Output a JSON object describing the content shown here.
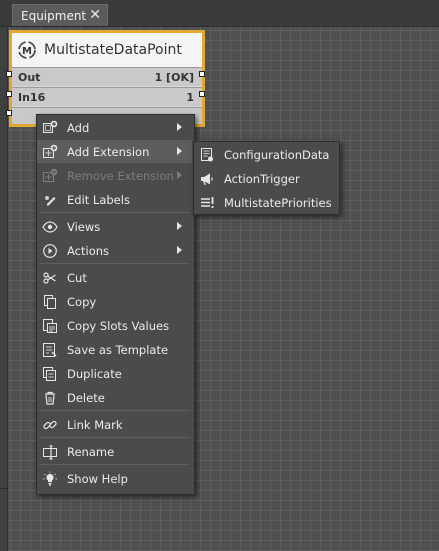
{
  "tab": {
    "label": "Equipment",
    "close": "✕"
  },
  "node": {
    "title": "MultistateDataPoint",
    "slots": [
      {
        "name": "Out",
        "value": "1 [OK]"
      },
      {
        "name": "In16",
        "value": "1"
      },
      {
        "name": "",
        "value": ""
      }
    ]
  },
  "context_menu": {
    "items": [
      {
        "label": "Add",
        "icon": "add-icon",
        "submenu": true
      },
      {
        "label": "Add Extension",
        "icon": "add-extension-icon",
        "submenu": true,
        "highlighted": true
      },
      {
        "label": "Remove Extension",
        "icon": "remove-extension-icon",
        "submenu": true,
        "disabled": true
      },
      {
        "label": "Edit Labels",
        "icon": "edit-labels-icon"
      },
      {
        "label": "Views",
        "icon": "eye-icon",
        "submenu": true
      },
      {
        "label": "Actions",
        "icon": "play-circle-icon",
        "submenu": true
      },
      {
        "label": "Cut",
        "icon": "scissors-icon"
      },
      {
        "label": "Copy",
        "icon": "copy-icon"
      },
      {
        "label": "Copy Slots Values",
        "icon": "copy-slots-icon"
      },
      {
        "label": "Save as Template",
        "icon": "save-template-icon"
      },
      {
        "label": "Duplicate",
        "icon": "duplicate-icon"
      },
      {
        "label": "Delete",
        "icon": "trash-icon"
      },
      {
        "label": "Link Mark",
        "icon": "link-icon"
      },
      {
        "label": "Rename",
        "icon": "rename-icon"
      },
      {
        "label": "Show Help",
        "icon": "lightbulb-icon"
      }
    ]
  },
  "submenu": {
    "items": [
      {
        "label": "ConfigurationData",
        "icon": "configuration-data-icon"
      },
      {
        "label": "ActionTrigger",
        "icon": "megaphone-icon"
      },
      {
        "label": "MultistatePriorities",
        "icon": "priorities-icon"
      }
    ]
  },
  "colors": {
    "node_border": "#e3a830",
    "menu_bg": "#4a4b4b",
    "menu_highlight": "#5c5d5d",
    "canvas_bg": "#4f5050"
  }
}
